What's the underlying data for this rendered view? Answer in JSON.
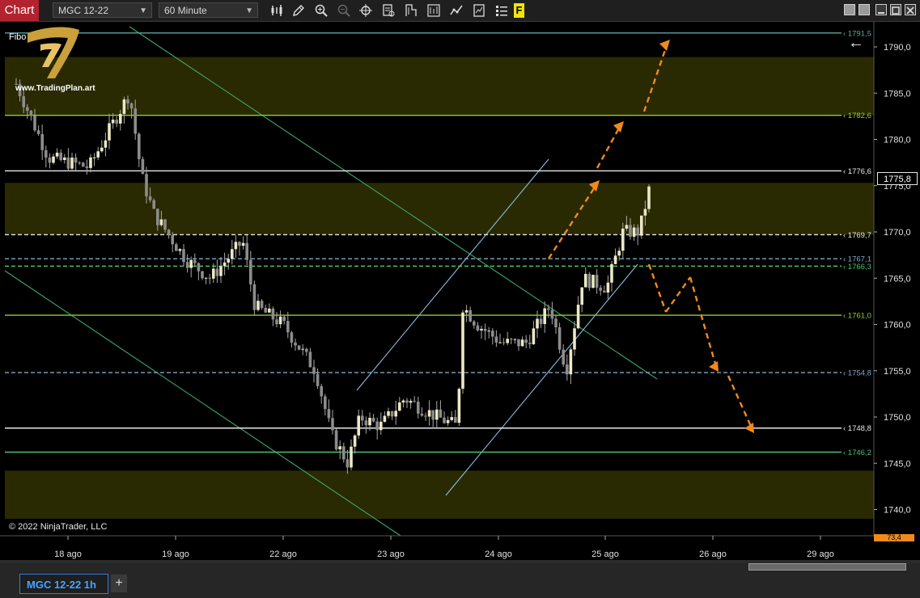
{
  "toolbar": {
    "chart_tab": "Chart",
    "instrument": "MGC 12-22",
    "interval": "60 Minute",
    "highlight_label": "F"
  },
  "chart": {
    "indicator_label": "Fibo",
    "watermark_url": "www.TradingPlan.art",
    "copyright": "© 2022 NinjaTrader, LLC",
    "current_price": "1775,8",
    "clipped_price": "73,4",
    "back_arrow": "←"
  },
  "chart_data": {
    "type": "candlestick",
    "y_ticks": [
      "1790,0",
      "1785,0",
      "1780,0",
      "1775,0",
      "1770,0",
      "1765,0",
      "1760,0",
      "1755,0",
      "1750,0",
      "1745,0",
      "1740,0"
    ],
    "ylim": [
      1739.0,
      1792.5
    ],
    "x_ticks": [
      "18 ago",
      "19 ago",
      "22 ago",
      "23 ago",
      "24 ago",
      "25 ago",
      "26 ago",
      "29 ago"
    ],
    "horizontal_levels": [
      {
        "value": 1791.5,
        "label": "1791,5",
        "color": "#5aa6a6",
        "style": "solid"
      },
      {
        "value": 1782.6,
        "label": "1782,6",
        "color": "#8ecf2a",
        "style": "solid"
      },
      {
        "value": 1776.6,
        "label": "1776,6",
        "color": "#e8e8e8",
        "style": "solid"
      },
      {
        "value": 1769.7,
        "label": "1769,7",
        "color": "#e8e8e8",
        "style": "dashed"
      },
      {
        "value": 1767.1,
        "label": "1767,1",
        "color": "#7fa8c8",
        "style": "dashed"
      },
      {
        "value": 1766.3,
        "label": "1766,3",
        "color": "#4cc072",
        "style": "dashed"
      },
      {
        "value": 1761.0,
        "label": "1761,0",
        "color": "#8ecf2a",
        "style": "solid"
      },
      {
        "value": 1754.8,
        "label": "1754,8",
        "color": "#7fa8c8",
        "style": "dashed"
      },
      {
        "value": 1748.8,
        "label": "1748,8",
        "color": "#e8e8e8",
        "style": "solid"
      },
      {
        "value": 1746.2,
        "label": "1746,2",
        "color": "#4cc072",
        "style": "solid"
      }
    ],
    "zones": [
      {
        "from": 1782.6,
        "to": 1788.9,
        "color": "#2a2a02"
      },
      {
        "from": 1769.7,
        "to": 1775.3,
        "color": "#2a2a02"
      },
      {
        "from": 1739.0,
        "to": 1744.2,
        "color": "#2a2a02"
      }
    ],
    "colors": {
      "up": "#ece8c4",
      "down": "#8c8c8c",
      "wick": "#a8a8a8",
      "arrow": "#f08a1c"
    }
  },
  "bottom": {
    "tab_label": "MGC 12-22 1h",
    "add_label": "+"
  }
}
